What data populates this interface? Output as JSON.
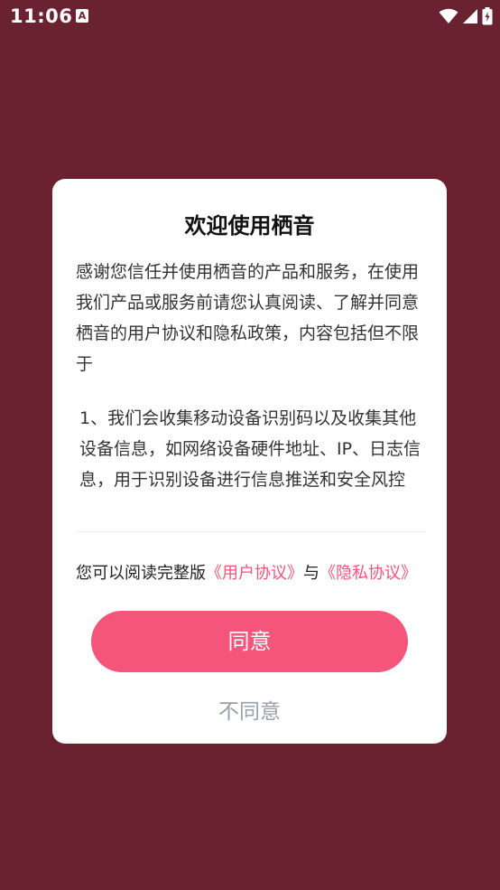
{
  "status_bar": {
    "time": "11:06",
    "app_icon_letter": "A",
    "icons": [
      "wifi-icon",
      "signal-icon",
      "battery-icon"
    ]
  },
  "dialog": {
    "title": "欢迎使用栖音",
    "paragraph1": "感谢您信任并使用栖音的产品和服务，在使用我们产品或服务前请您认真阅读、了解并同意栖音的用户协议和隐私政策，内容包括但不限于",
    "paragraph2": "1、我们会收集移动设备识别码以及收集其他设备信息，如网络设备硬件地址、IP、日志信息，用于识别设备进行信息推送和安全风控",
    "links_prefix": "您可以阅读完整版",
    "user_agreement_link": "《用户协议》",
    "links_connector": "与",
    "privacy_link": "《隐私协议》",
    "agree_label": "同意",
    "disagree_label": "不同意"
  },
  "colors": {
    "background": "#6b2230",
    "accent": "#f5557a",
    "link": "#f0557a",
    "secondary_text": "#9aa0aa"
  }
}
